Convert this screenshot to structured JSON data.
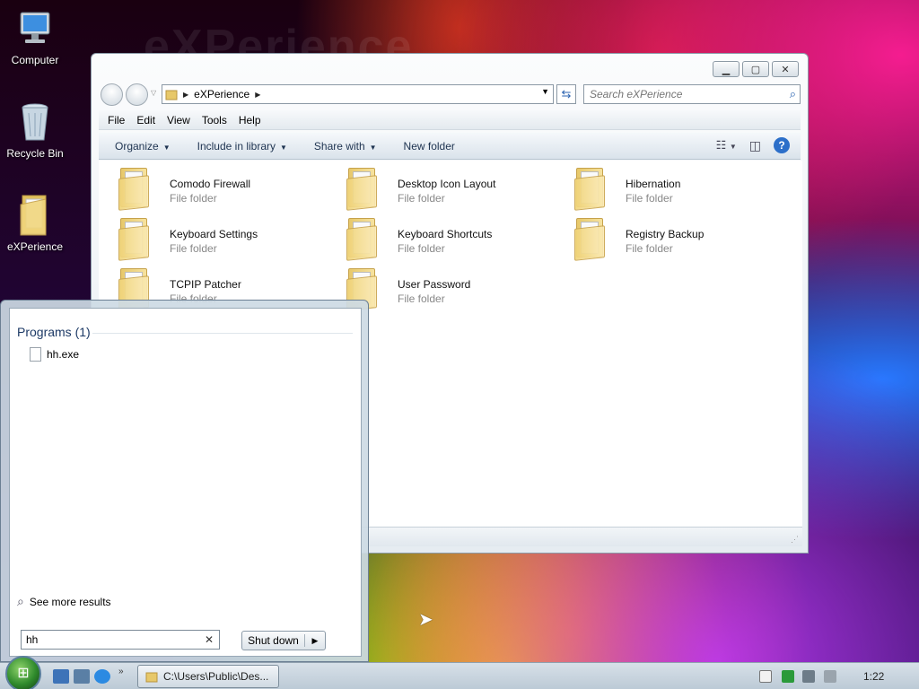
{
  "desktop": {
    "icons": [
      {
        "label": "Computer",
        "icon": "computer-icon"
      },
      {
        "label": "Recycle Bin",
        "icon": "recycle-bin-icon"
      },
      {
        "label": "eXPerience",
        "icon": "folder-icon"
      }
    ]
  },
  "explorer": {
    "address_crumb": "eXPerience",
    "search_placeholder": "Search eXPerience",
    "menu": [
      "File",
      "Edit",
      "View",
      "Tools",
      "Help"
    ],
    "commands": [
      "Organize",
      "Include in library",
      "Share with",
      "New folder"
    ],
    "items": [
      {
        "name": "Comodo Firewall",
        "type": "File folder"
      },
      {
        "name": "Desktop Icon Layout",
        "type": "File folder"
      },
      {
        "name": "Hibernation",
        "type": "File folder"
      },
      {
        "name": "Keyboard Settings",
        "type": "File folder"
      },
      {
        "name": "Keyboard Shortcuts",
        "type": "File folder"
      },
      {
        "name": "Registry Backup",
        "type": "File folder"
      },
      {
        "name": "TCPIP Patcher",
        "type": "File folder"
      },
      {
        "name": "User Password",
        "type": "File folder"
      }
    ]
  },
  "start_menu": {
    "section_title": "Programs (1)",
    "program": "hh.exe",
    "see_more": "See more results",
    "search_value": "hh",
    "shutdown_label": "Shut down"
  },
  "taskbar": {
    "task_label": "C:\\Users\\Public\\Des...",
    "clock": "1:22"
  },
  "colors": {
    "accent": "#2a62b0",
    "section_text": "#1d3a66"
  }
}
